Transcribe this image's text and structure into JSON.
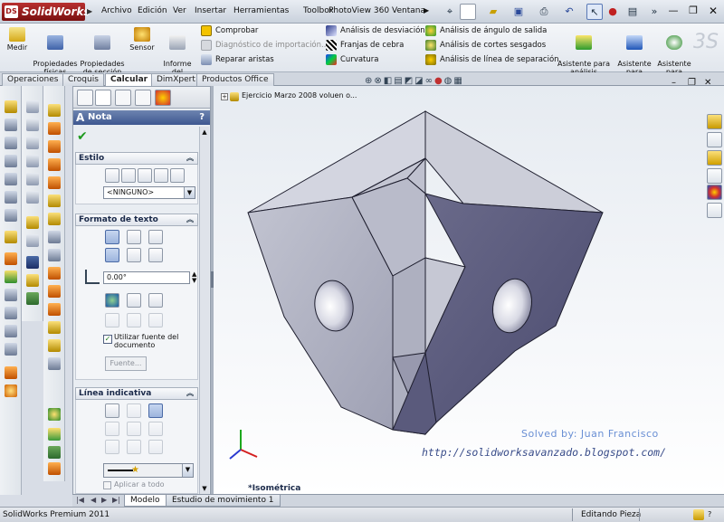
{
  "app": {
    "logo": "SolidWorks",
    "logo_badge": "DS"
  },
  "menu": [
    "Archivo",
    "Edición",
    "Ver",
    "Insertar",
    "Herramientas",
    "Toolbox",
    "PhotoView 360",
    "Ventana"
  ],
  "command_manager": {
    "big_buttons": [
      {
        "label": "Medir",
        "icon": "ruler-icon"
      },
      {
        "label": "Propiedades\nfísicas",
        "icon": "mass-properties-icon"
      },
      {
        "label": "Propiedades\nde sección",
        "icon": "section-properties-icon"
      },
      {
        "label": "Sensor",
        "icon": "sensor-icon"
      },
      {
        "label": "Informe\ndel\ntiempo...",
        "icon": "statistics-icon"
      }
    ],
    "check_items": [
      {
        "label": "Comprobar",
        "enabled": true
      },
      {
        "label": "Diagnóstico de importación...",
        "enabled": false
      },
      {
        "label": "Reparar aristas",
        "enabled": true
      }
    ],
    "analysis_col1": [
      "Análisis de desviación",
      "Franjas de cebra",
      "Curvatura"
    ],
    "analysis_col2": [
      "Análisis de ángulo de salida",
      "Análisis de cortes sesgados",
      "Análisis de línea de separación"
    ],
    "wizards": [
      {
        "label": "Asistente para\nanálisis\nSimulationXpress"
      },
      {
        "label": "Asistente\npara\nanálisi..."
      },
      {
        "label": "Asistente\npara\nanálisi..."
      }
    ]
  },
  "tabs": [
    "Operaciones",
    "Croquis",
    "Calcular",
    "DimXpert",
    "Productos Office"
  ],
  "active_tab": "Calcular",
  "property_manager": {
    "title": "Nota",
    "help": "?",
    "sections": {
      "estilo": {
        "header": "Estilo",
        "style_select": "<NINGUNO>"
      },
      "formato": {
        "header": "Formato de texto",
        "angle": "0.00°",
        "use_doc_font": "Utilizar fuente del documento",
        "use_doc_font_checked": true,
        "font_button": "Fuente..."
      },
      "linea": {
        "header": "Línea indicativa",
        "apply_all": "Aplicar a todo"
      }
    }
  },
  "viewport": {
    "tree_item": "Ejercicio Marzo 2008 voluen o...",
    "view_label": "*Isométrica",
    "watermark_1": "Solved by: Juan Francisco",
    "watermark_2": "http://solidworksavanzado.blogspot.com/"
  },
  "bottom_tabs": [
    "Modelo",
    "Estudio de movimiento 1"
  ],
  "status": {
    "left": "SolidWorks Premium 2011",
    "right": "Editando Pieza"
  },
  "colors": {
    "part_light": "#b9bccb",
    "part_mid": "#a8aabb",
    "part_dark": "#56567a",
    "title_blue": "#3e5790"
  }
}
